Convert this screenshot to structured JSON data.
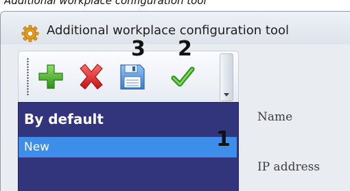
{
  "caption": "Additional workplace configuration tool",
  "window": {
    "title": "Additional workplace configuration tool",
    "icon": "gear-icon"
  },
  "toolbar": {
    "buttons": [
      {
        "icon": "plus-icon",
        "color": "#3fa62a"
      },
      {
        "icon": "delete-x-icon",
        "color": "#d42020"
      },
      {
        "icon": "save-icon",
        "color": "#3a7fd0"
      },
      {
        "icon": "checkmark-icon",
        "color": "#3fa62a"
      }
    ]
  },
  "callouts": {
    "save": "3",
    "apply": "2",
    "list_item": "1"
  },
  "list": {
    "header": "By default",
    "items": [
      {
        "label": "New",
        "selected": true
      }
    ],
    "background_color": "#33357c",
    "selected_color": "#3d8ee8"
  },
  "details": {
    "name_label": "Name",
    "ip_label": "IP address"
  }
}
